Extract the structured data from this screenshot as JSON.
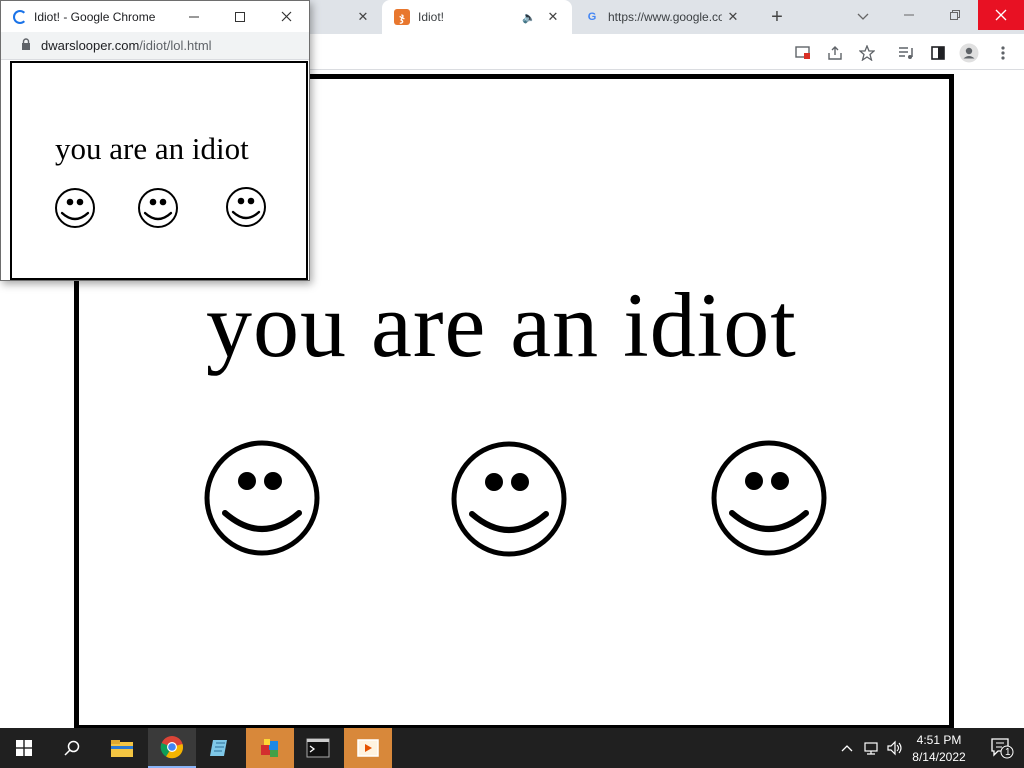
{
  "browser": {
    "tabs": [
      {
        "title": "",
        "active": false
      },
      {
        "title": "Idiot!",
        "active": true
      },
      {
        "title": "https://www.google.com",
        "active": false
      }
    ],
    "tab_close": "✕",
    "new_tab": "+"
  },
  "page": {
    "heading": "you are an idiot",
    "smiley_count": 3
  },
  "popup": {
    "title": "Idiot! - Google Chrome",
    "url_domain": "dwarslooper.com",
    "url_path": "/idiot/lol.html",
    "heading": "you are an idiot"
  },
  "taskbar": {
    "time": "4:51 PM",
    "date": "8/14/2022",
    "notification_count": "1"
  },
  "colors": {
    "close_red": "#e81123",
    "tab_strip": "#dfe3e8",
    "taskbar": "#202020",
    "highlight_orange": "#d8883a"
  }
}
